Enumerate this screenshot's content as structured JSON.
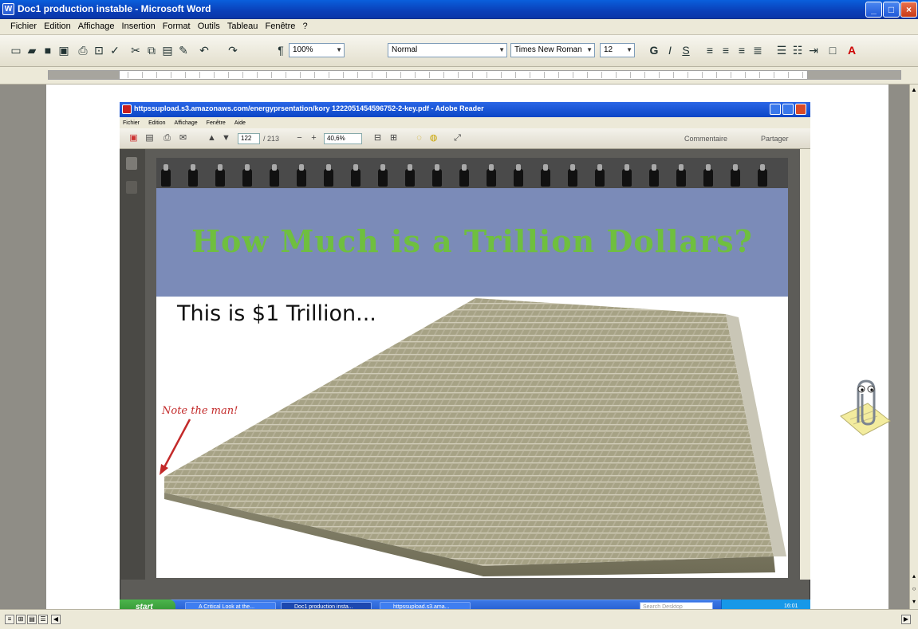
{
  "word": {
    "title": "Doc1 production instable - Microsoft Word",
    "menu": [
      "Fichier",
      "Edition",
      "Affichage",
      "Insertion",
      "Format",
      "Outils",
      "Tableau",
      "Fenêtre",
      "?"
    ],
    "toolbar": {
      "zoom": "100%",
      "style": "Normal",
      "font": "Times New Roman",
      "size": "12",
      "bold": "G",
      "italic": "I",
      "underline": "S"
    }
  },
  "reader": {
    "title": "httpssupload.s3.amazonaws.com/energyprsentation/kory 1222051454596752-2-key.pdf - Adobe Reader",
    "menu": [
      "Fichier",
      "Edition",
      "Affichage",
      "Fenêtre",
      "Aide"
    ],
    "page_current": "122",
    "page_total": "/ 213",
    "zoom": "40,6%",
    "comment_label": "Commentaire",
    "share_label": "Partager"
  },
  "slide": {
    "title": "How Much is a Trillion Dollars?",
    "subtitle": "This is $1 Trillion...",
    "note": "Note the man!"
  },
  "inner_taskbar": {
    "start_label": "start",
    "buttons": [
      "A Critical Look at the...",
      "Doc1 production insta...",
      "httpssupload.s3.ama..."
    ],
    "search_placeholder": "Search Desktop",
    "clock": "16:01"
  },
  "colors": {
    "title_bar": "#0a46c6",
    "slide_header": "#7b8bb8",
    "slide_title": "#6fbf3f",
    "note": "#c32a2a"
  }
}
